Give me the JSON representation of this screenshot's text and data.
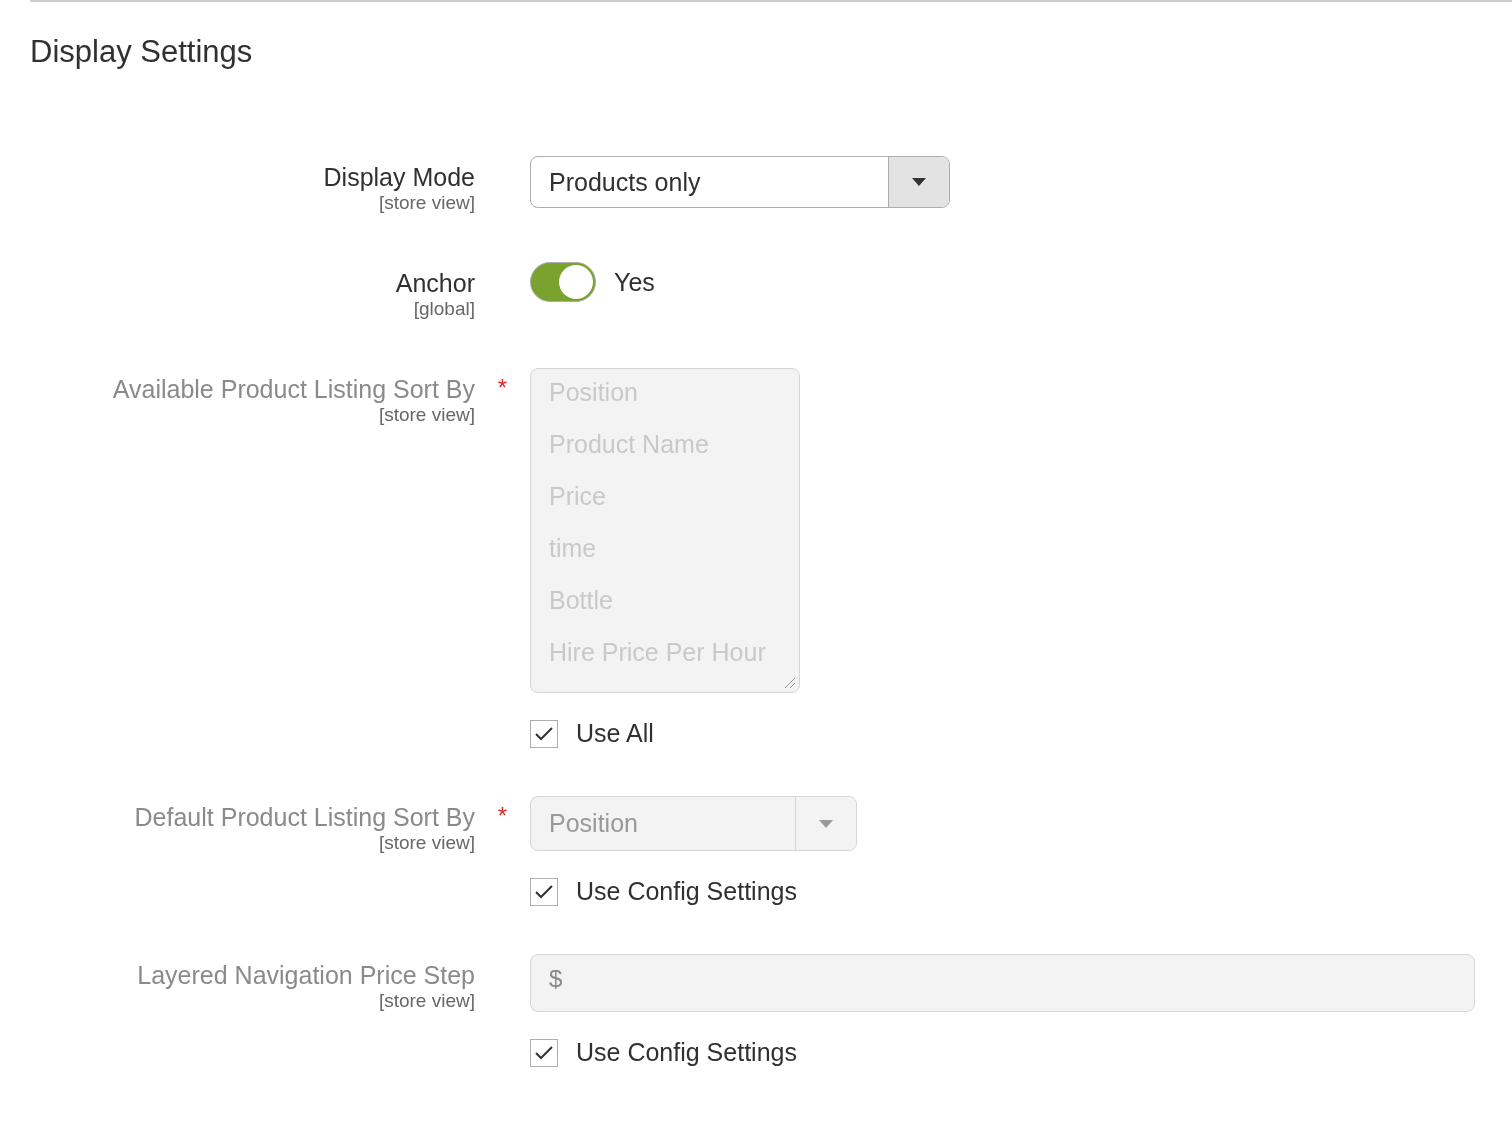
{
  "section": {
    "title": "Display Settings"
  },
  "fields": [
    {
      "kind": "select",
      "label": "Display Mode",
      "scope": "[store view]",
      "disabled": false,
      "value": "Products only"
    },
    {
      "kind": "toggle",
      "label": "Anchor",
      "scope": "[global]",
      "disabled": false,
      "on": true,
      "value": "Yes"
    },
    {
      "kind": "multiselect",
      "label": "Available Product Listing Sort By",
      "scope": "[store view]",
      "required_mark": "*",
      "disabled": true,
      "options": [
        "Position",
        "Product Name",
        "Price",
        "time",
        "Bottle",
        "Hire Price Per Hour"
      ],
      "checkbox": {
        "label": "Use All",
        "checked": true
      }
    },
    {
      "kind": "select",
      "label": "Default Product Listing Sort By",
      "scope": "[store view]",
      "required_mark": "*",
      "disabled": true,
      "value": "Position",
      "checkbox": {
        "label": "Use Config Settings",
        "checked": true
      }
    },
    {
      "kind": "text",
      "label": "Layered Navigation Price Step",
      "scope": "[store view]",
      "disabled": true,
      "prefix": "$",
      "checkbox": {
        "label": "Use Config Settings",
        "checked": true
      }
    }
  ]
}
